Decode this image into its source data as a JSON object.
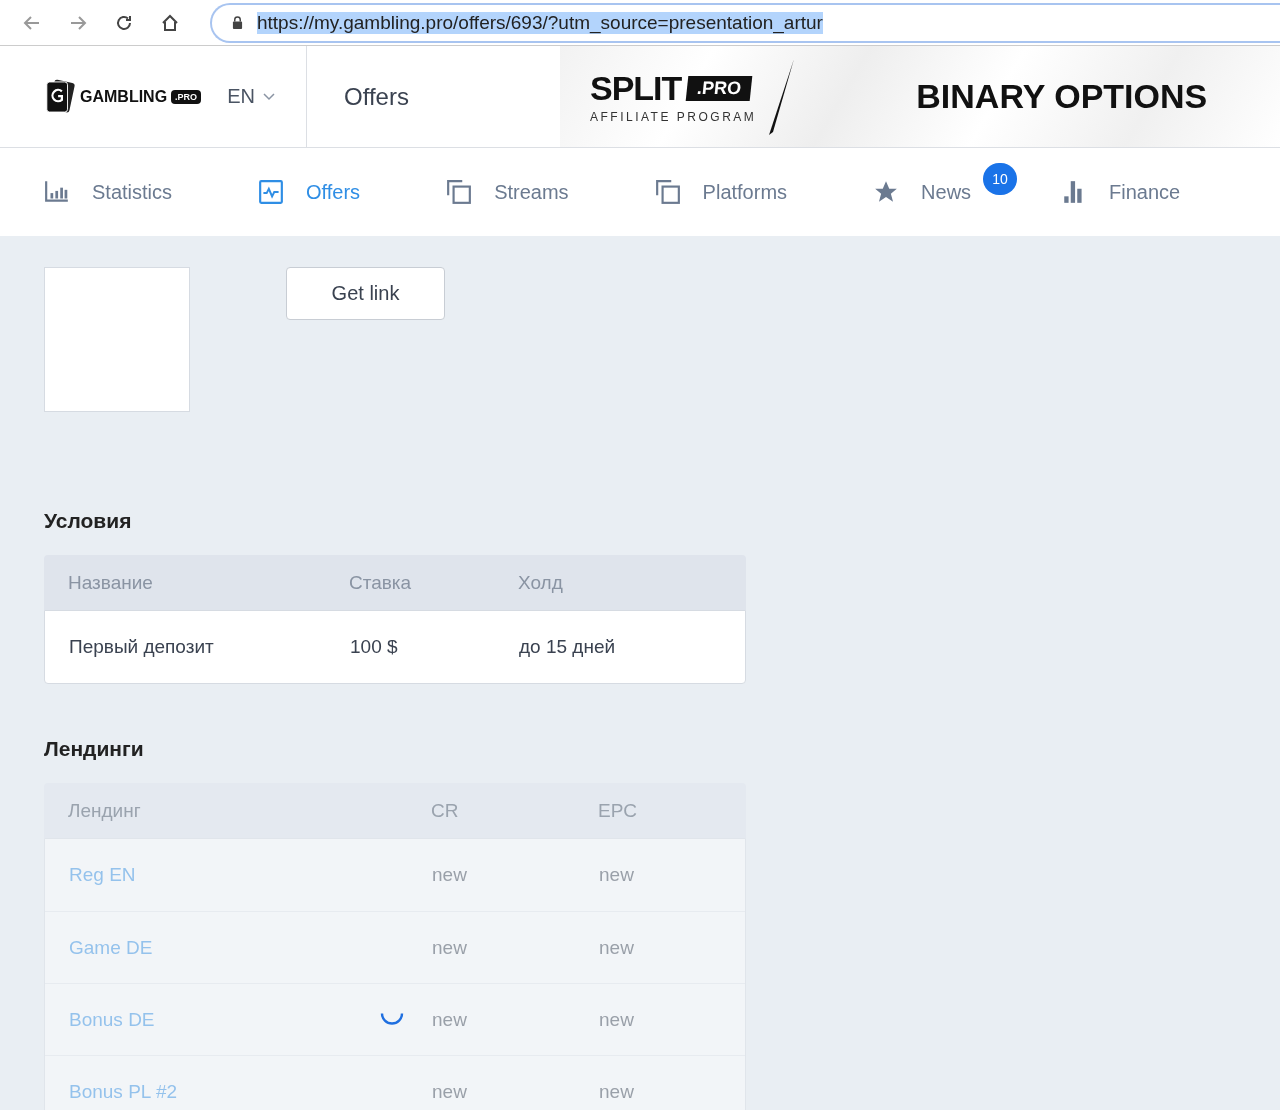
{
  "browser": {
    "url": "https://my.gambling.pro/offers/693/?utm_source=presentation_artur",
    "url_selected": true
  },
  "header": {
    "logo": {
      "name": "GAMBLING",
      "suffix": ".PRO"
    },
    "language": "EN",
    "page_title": "Offers",
    "banner": {
      "brand": "SPLIT",
      "brand_suffix": ".PRO",
      "tagline": "AFFILIATE PROGRAM",
      "headline": "BINARY OPTIONS"
    }
  },
  "nav": [
    {
      "label": "Statistics",
      "kind": "bars",
      "selected": false
    },
    {
      "label": "Offers",
      "kind": "chart",
      "selected": true
    },
    {
      "label": "Streams",
      "kind": "copy",
      "selected": false
    },
    {
      "label": "Platforms",
      "kind": "copy",
      "selected": false
    },
    {
      "label": "News",
      "kind": "star",
      "selected": false,
      "badge": "10"
    },
    {
      "label": "Finance",
      "kind": "finance",
      "selected": false
    }
  ],
  "offer": {
    "get_link": "Get link"
  },
  "conditions": {
    "title": "Условия",
    "columns": [
      "Название",
      "Ставка",
      "Холд"
    ],
    "rows": [
      [
        "Первый депозит",
        "100 $",
        "до 15 дней"
      ]
    ]
  },
  "landings": {
    "title": "Лендинги",
    "loading": true,
    "columns": [
      "Лендинг",
      "CR",
      "EPC"
    ],
    "rows": [
      [
        "Reg EN",
        "new",
        "new"
      ],
      [
        "Game DE",
        "new",
        "new"
      ],
      [
        "Bonus DE",
        "new",
        "new"
      ],
      [
        "Bonus PL #2",
        "new",
        "new"
      ]
    ]
  }
}
